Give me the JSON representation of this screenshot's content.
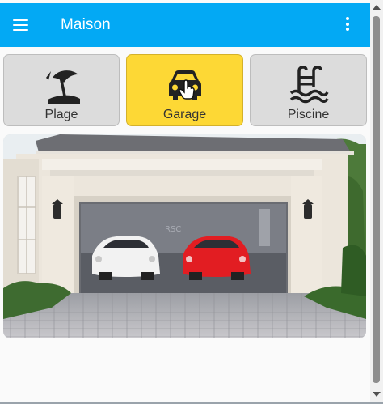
{
  "app": {
    "title": "Maison",
    "menu_icon": "hamburger-menu-icon",
    "overflow_icon": "more-vertical-icon",
    "colors": {
      "appbar": "#03a9f4",
      "active_tile": "#fdd835",
      "tile": "#dcdcdc"
    }
  },
  "tiles": [
    {
      "label": "Plage",
      "icon": "beach-umbrella-icon",
      "active": false
    },
    {
      "label": "Garage",
      "icon": "car-icon",
      "active": true
    },
    {
      "label": "Piscine",
      "icon": "pool-icon",
      "active": false
    }
  ],
  "camera": {
    "description_icon": "garage-camera-image",
    "sign_text": "RSC"
  }
}
